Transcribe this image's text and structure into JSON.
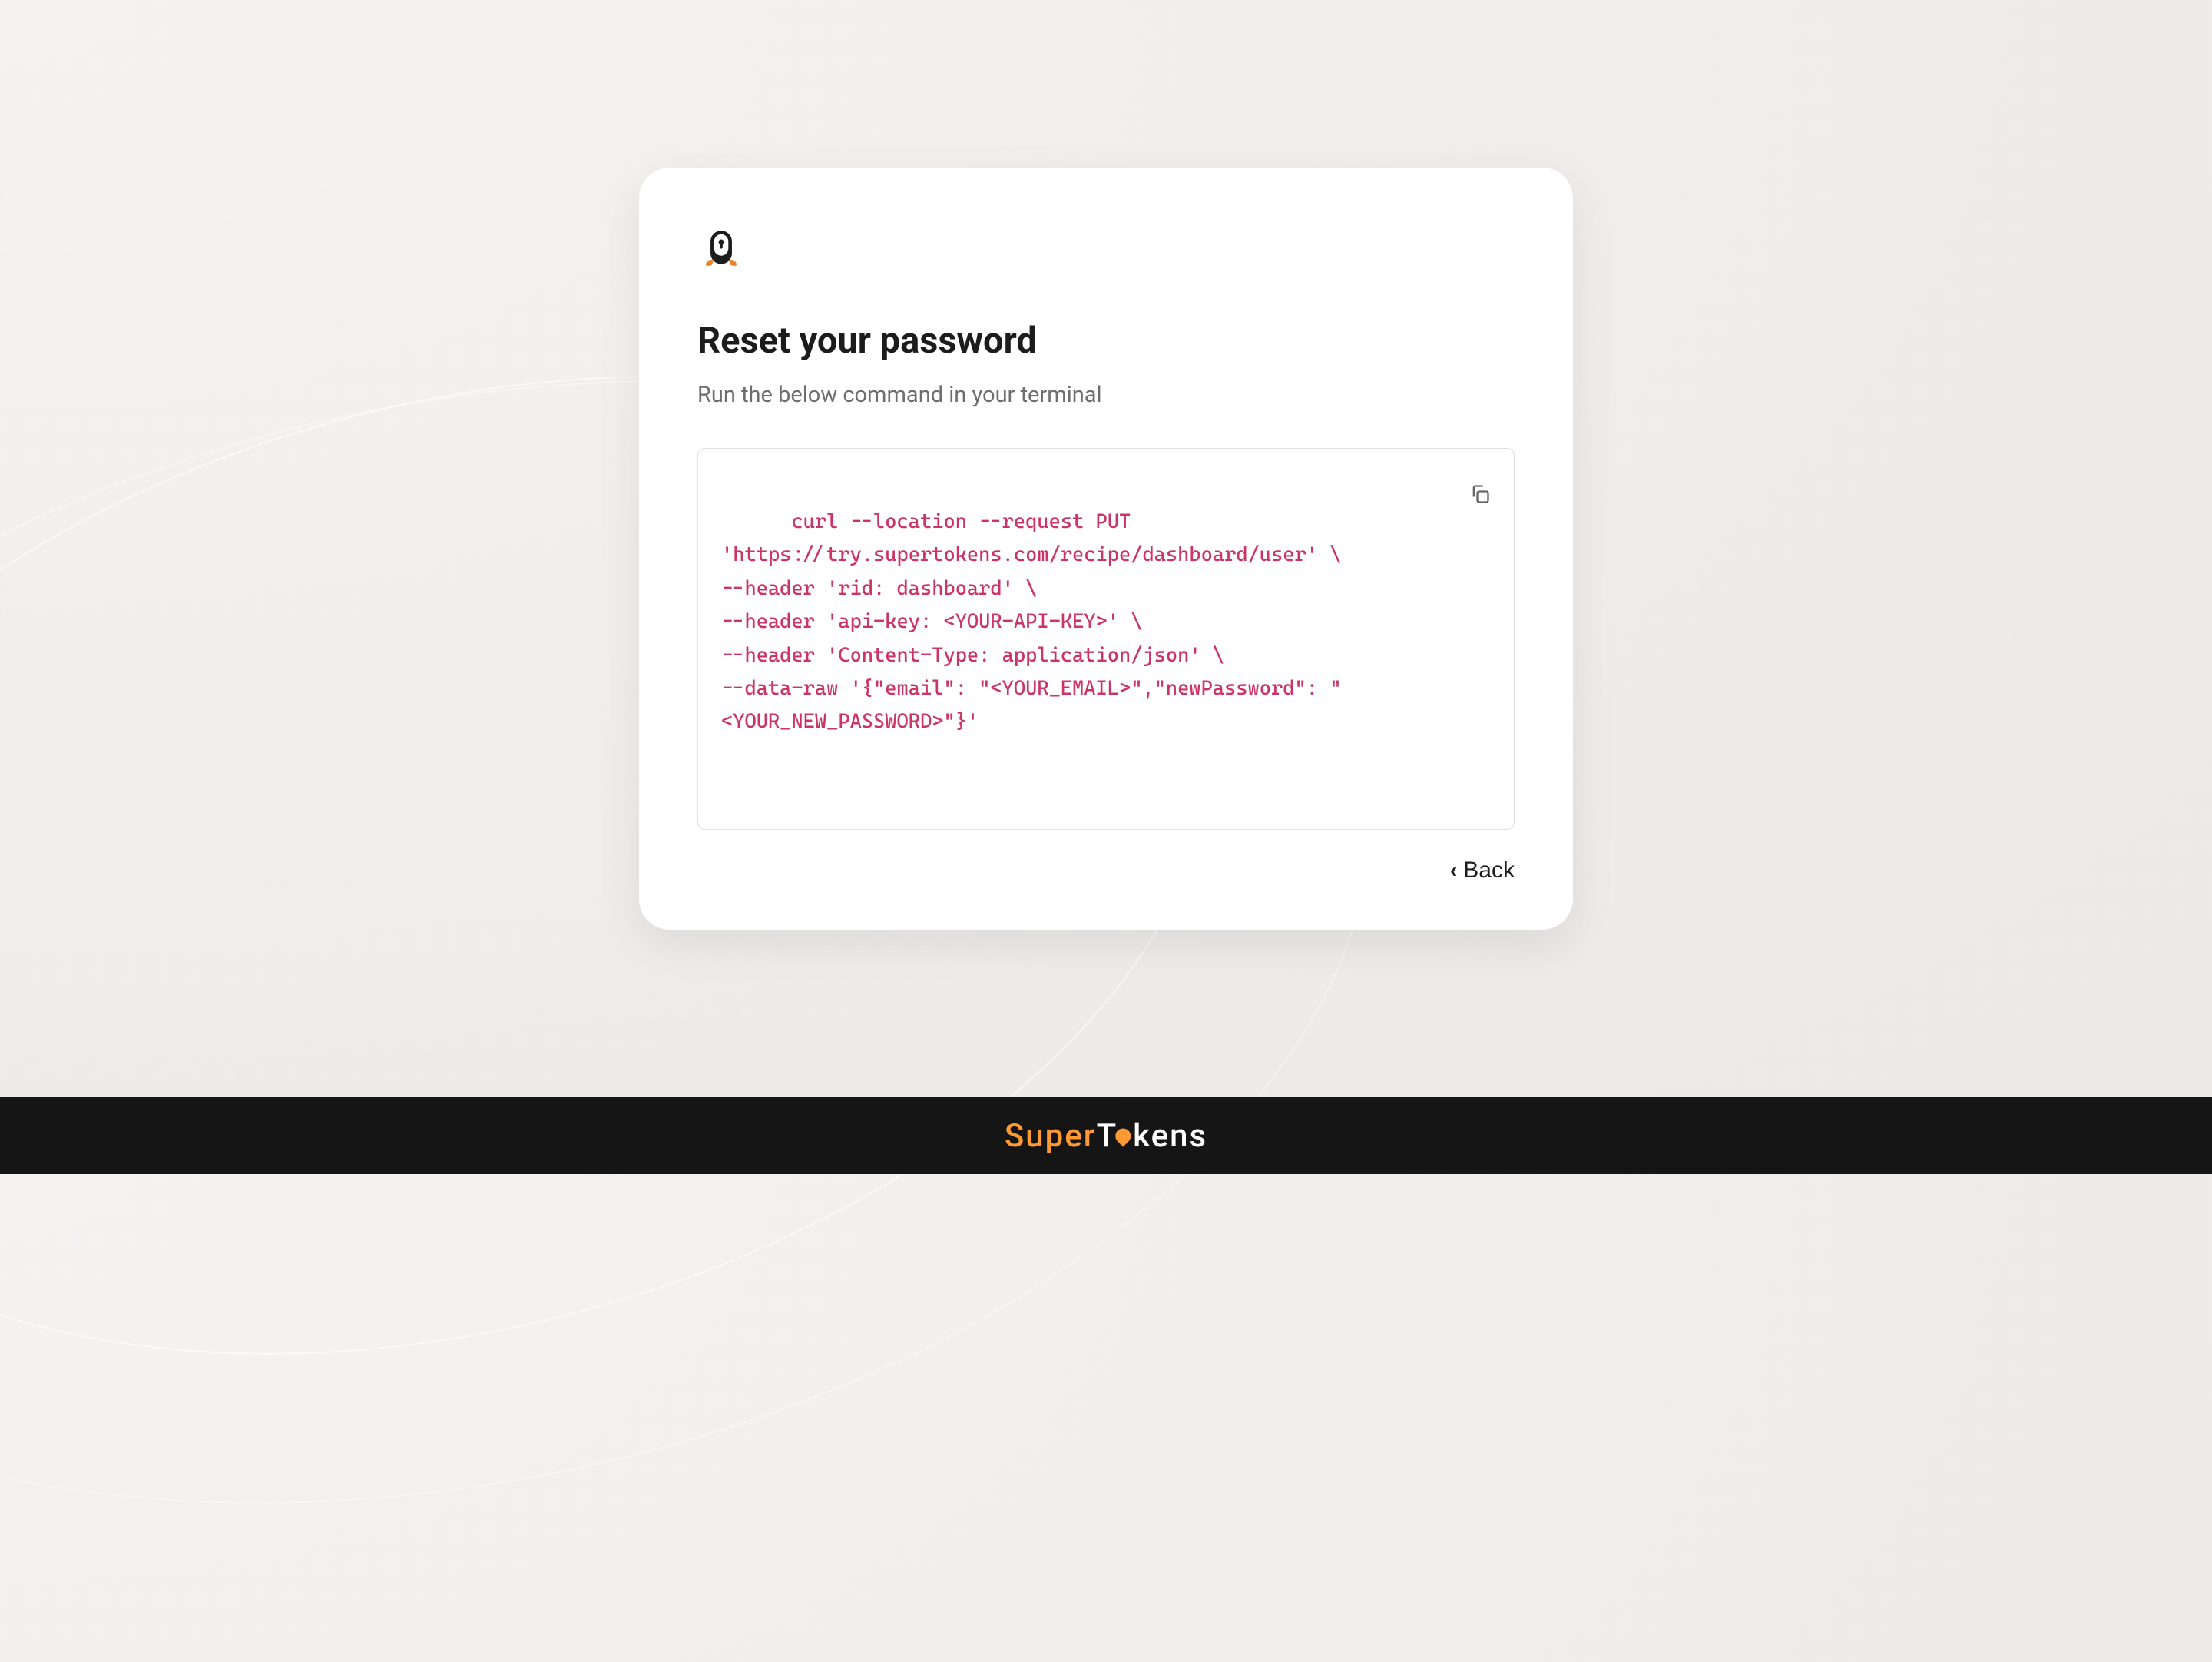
{
  "card": {
    "title": "Reset your password",
    "subtitle": "Run the below command in your terminal",
    "code": "curl --location --request PUT 'https://try.supertokens.com/recipe/dashboard/user' \\\n--header 'rid: dashboard' \\\n--header 'api-key: <YOUR-API-KEY>' \\\n--header 'Content-Type: application/json' \\\n--data-raw '{\"email\": \"<YOUR_EMAIL>\",\"newPassword\": \"<YOUR_NEW_PASSWORD>\"}'",
    "back_label": "Back"
  },
  "footer": {
    "brand_prefix": "Super",
    "brand_t": "T",
    "brand_suffix": "kens"
  }
}
